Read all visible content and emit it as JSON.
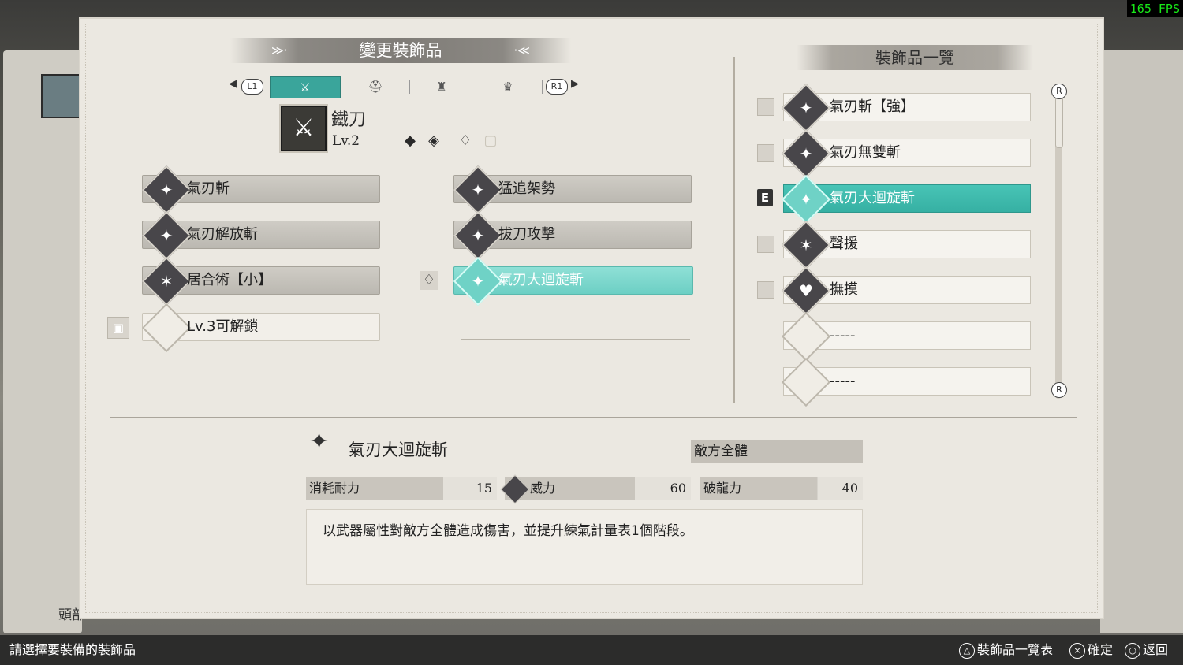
{
  "overlay": {
    "fps": "165 FPS"
  },
  "background": {
    "label": "頭部"
  },
  "header": {
    "title": "變更裝飾品"
  },
  "tabs": {
    "left_button": "L1",
    "right_button": "R1"
  },
  "weapon": {
    "name": "鐵刀",
    "level": "Lv.2",
    "icon": "katana-icon"
  },
  "slots_left": [
    {
      "name": "氣刃斬",
      "icon": "spirit-blade-icon"
    },
    {
      "name": "氣刃解放斬",
      "icon": "spirit-blade-icon"
    },
    {
      "name": "居合術【小】",
      "icon": "figure-icon"
    },
    {
      "name": "Lv.3可解鎖",
      "icon": ""
    }
  ],
  "slots_right": [
    {
      "name": "猛追架勢",
      "icon": "spirit-blade-icon"
    },
    {
      "name": "拔刀攻擊",
      "icon": "spirit-blade-icon"
    },
    {
      "name": "氣刃大迴旋斬",
      "icon": "spirit-blade-icon"
    }
  ],
  "list": {
    "title": "裝飾品一覽",
    "items": [
      {
        "name": "氣刃斬【強】",
        "icon": "spirit-blade-icon"
      },
      {
        "name": "氣刃無雙斬",
        "icon": "spirit-blade-icon"
      },
      {
        "name": "氣刃大迴旋斬",
        "icon": "spirit-blade-icon"
      },
      {
        "name": "聲援",
        "icon": "figure-icon"
      },
      {
        "name": "撫摸",
        "icon": "heart-icon"
      },
      {
        "name": "-----",
        "icon": ""
      },
      {
        "name": "-----",
        "icon": ""
      }
    ],
    "equipped_mark": "E",
    "scroll_button": "R"
  },
  "detail": {
    "name": "氣刃大迴旋斬",
    "target": "敵方全體",
    "stats": [
      {
        "label": "消耗耐力",
        "value": "15"
      },
      {
        "label": "威力",
        "value": "60"
      },
      {
        "label": "破龍力",
        "value": "40"
      }
    ],
    "description": "以武器屬性對敵方全體造成傷害，並提升練氣計量表1個階段。"
  },
  "footer": {
    "prompt": "請選擇要裝備的裝飾品",
    "hints": [
      {
        "glyph": "△",
        "label": "裝飾品一覽表"
      },
      {
        "glyph": "×",
        "label": "確定"
      },
      {
        "glyph": "○",
        "label": "返回"
      }
    ]
  },
  "colors": {
    "accent": "#3aa59b",
    "highlight": "#6fd2c6",
    "panel": "#ebe8e1"
  }
}
